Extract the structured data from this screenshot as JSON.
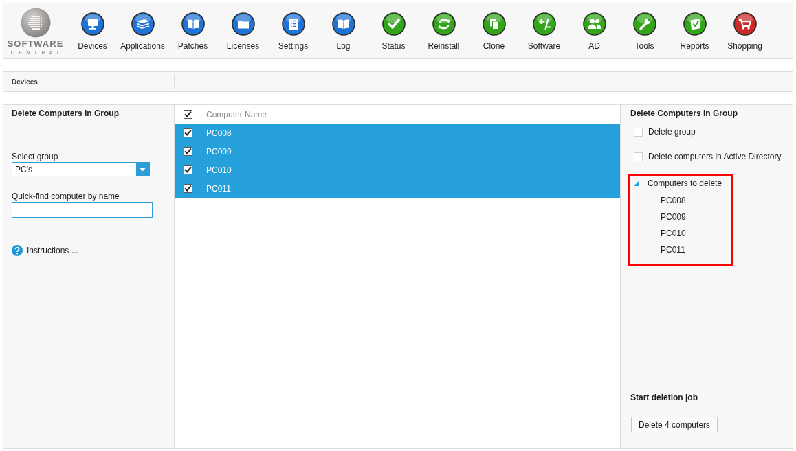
{
  "toolbar": {
    "logo": {
      "title": "SOFTWARE",
      "subtitle": "CENTRAL"
    },
    "items": [
      {
        "label": "Devices",
        "color": "#1f72d6"
      },
      {
        "label": "Applications",
        "color": "#1f72d6"
      },
      {
        "label": "Patches",
        "color": "#1f72d6"
      },
      {
        "label": "Licenses",
        "color": "#1f72d6"
      },
      {
        "label": "Settings",
        "color": "#1f72d6"
      },
      {
        "label": "Log",
        "color": "#1f72d6"
      },
      {
        "label": "Status",
        "color": "#33a51b"
      },
      {
        "label": "Reinstall",
        "color": "#33a51b"
      },
      {
        "label": "Clone",
        "color": "#33a51b"
      },
      {
        "label": "Software",
        "color": "#33a51b"
      },
      {
        "label": "AD",
        "color": "#33a51b"
      },
      {
        "label": "Tools",
        "color": "#33a51b"
      },
      {
        "label": "Reports",
        "color": "#33a51b"
      },
      {
        "label": "Shopping",
        "color": "#c92a2a"
      }
    ]
  },
  "breadcrumb": {
    "label": "Devices"
  },
  "left_panel": {
    "title": "Delete Computers In Group",
    "group_select": {
      "label": "Select group",
      "value": "PC's"
    },
    "quick_find": {
      "label": "Quick-find computer by name",
      "focused": true
    },
    "instructions": "Instructions ..."
  },
  "computer_list": {
    "header": {
      "label": "Computer Name",
      "checked": true
    },
    "rows": [
      {
        "name": "PC008",
        "checked": true,
        "selected": true
      },
      {
        "name": "PC009",
        "checked": true,
        "selected": true
      },
      {
        "name": "PC010",
        "checked": true,
        "selected": true
      },
      {
        "name": "PC011",
        "checked": true,
        "selected": true
      }
    ]
  },
  "right_panel": {
    "title": "Delete Computers In Group",
    "options": [
      {
        "label": "Delete group",
        "checked": false
      },
      {
        "label": "Delete computers in Active Directory",
        "checked": false
      }
    ],
    "tree": {
      "label": "Computers to delete",
      "expanded": true,
      "highlighted": true,
      "children": [
        {
          "label": "PC008"
        },
        {
          "label": "PC009"
        },
        {
          "label": "PC010"
        },
        {
          "label": "PC011"
        }
      ]
    },
    "job": {
      "title": "Start deletion job",
      "button": "Delete 4 computers"
    }
  }
}
